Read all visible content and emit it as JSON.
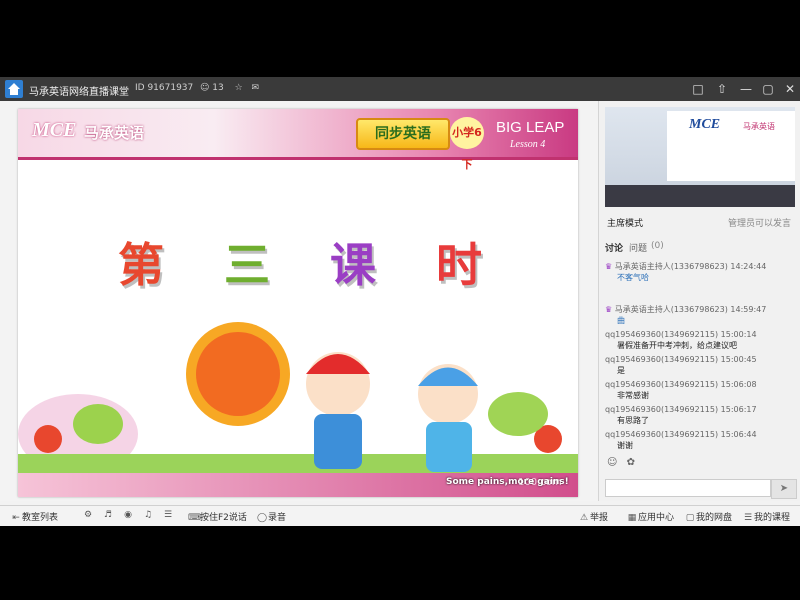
{
  "titlebar": {
    "title": "马承英语网络直播课堂",
    "room_id": "ID 91671937",
    "viewer_count": "13",
    "icons": [
      "home-icon",
      "user-icon",
      "star-icon",
      "chat-icon",
      "square-icon",
      "share-icon",
      "restore-icon",
      "close-icon"
    ]
  },
  "slide": {
    "logo": "MCE",
    "logo_cn": "马承英语",
    "badge": "同步英语",
    "grade": "小学6下",
    "leap": "BIG LEAP",
    "lesson_sub": "Lesson 4",
    "lesson_title": [
      "第",
      "三",
      "课",
      "时"
    ],
    "footer_caption": "Some pains,more gains!",
    "watermark": "100.com"
  },
  "video": {
    "logo": "MCE",
    "logo_sub": "马承英语",
    "mode_label": "主席模式",
    "mode_right": "管理员可以发言"
  },
  "chat": {
    "tabs": [
      "讨论",
      "问题",
      "(0)"
    ],
    "messages": [
      {
        "who": "马承英语主持人(1336798623)",
        "time": "14:24:44",
        "body": "不客气哈",
        "link": true
      },
      {
        "who": "马承英语主持人(1336798623)",
        "time": "14:59:47",
        "body": "曲",
        "link": true
      },
      {
        "who": "qq195469360(1349692115)",
        "time": "15:00:14",
        "body": "暑假准备开中考冲刺，给点建议吧",
        "link": false
      },
      {
        "who": "qq195469360(1349692115)",
        "time": "15:00:45",
        "body": "是",
        "link": false
      },
      {
        "who": "qq195469360(1349692115)",
        "time": "15:06:08",
        "body": "非常感谢",
        "link": false
      },
      {
        "who": "qq195469360(1349692115)",
        "time": "15:06:17",
        "body": "有思路了",
        "link": false
      },
      {
        "who": "qq195469360(1349692115)",
        "time": "15:06:44",
        "body": "谢谢",
        "link": false
      }
    ],
    "send_icon": "send-icon"
  },
  "toolbar": {
    "left": [
      "教室列表"
    ],
    "mid": [
      "按住F2说话",
      "录音"
    ],
    "right": [
      "举报",
      "应用中心",
      "我的网盘",
      "我的课程"
    ]
  },
  "colors": {
    "titlebar": "#3a3a3a",
    "accent": "#c0326f",
    "chat_link": "#2a6fb8"
  }
}
